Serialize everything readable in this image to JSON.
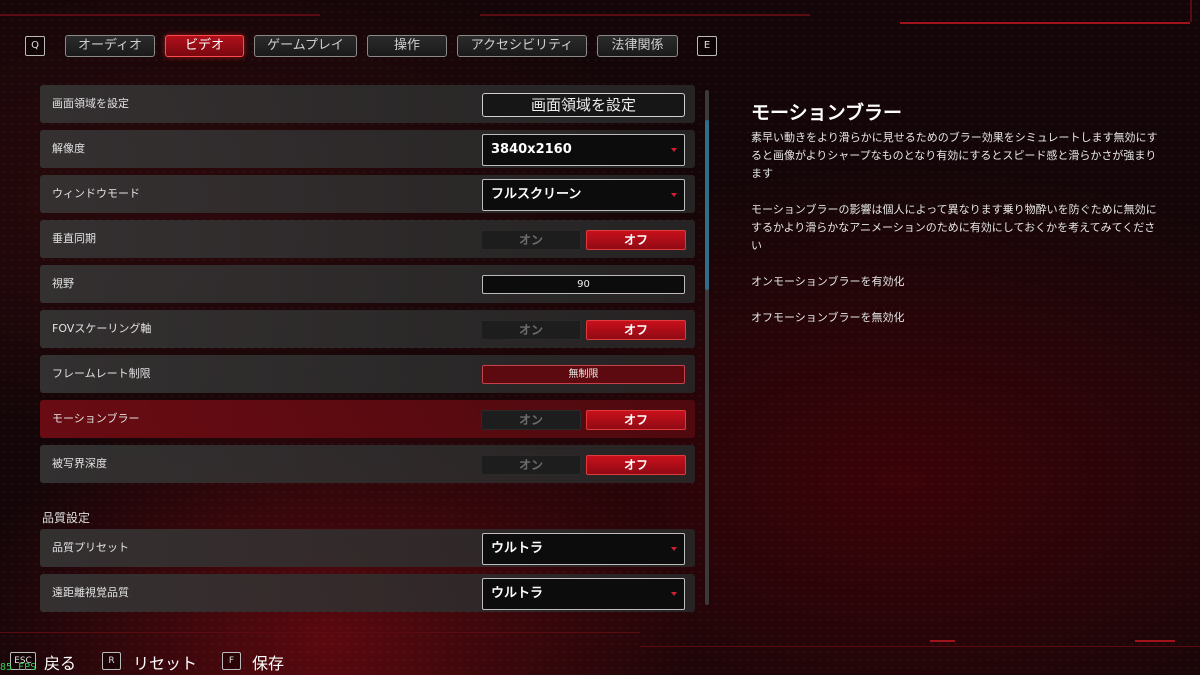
{
  "tabs": {
    "prev_key": "Q",
    "next_key": "E",
    "items": [
      {
        "label": "オーディオ"
      },
      {
        "label": "ビデオ"
      },
      {
        "label": "ゲームプレイ"
      },
      {
        "label": "操作"
      },
      {
        "label": "アクセシビリティ"
      },
      {
        "label": "法律関係"
      }
    ],
    "active": "ビデオ"
  },
  "settings": {
    "screen_area": {
      "label": "画面領域を設定",
      "button": "画面領域を設定"
    },
    "resolution": {
      "label": "解像度",
      "value": "3840x2160"
    },
    "window_mode": {
      "label": "ウィンドウモード",
      "value": "フルスクリーン"
    },
    "vsync": {
      "label": "垂直同期",
      "on": "オン",
      "off": "オフ",
      "selected": "オフ"
    },
    "fov": {
      "label": "視野",
      "value": "90"
    },
    "fov_scaling": {
      "label": "FOVスケーリング軸",
      "on": "オン",
      "off": "オフ",
      "selected": "オフ"
    },
    "framerate_limit": {
      "label": "フレームレート制限",
      "value": "無制限"
    },
    "motion_blur": {
      "label": "モーションブラー",
      "on": "オン",
      "off": "オフ",
      "selected": "オフ"
    },
    "depth_of_field": {
      "label": "被写界深度",
      "on": "オン",
      "off": "オフ",
      "selected": "オフ"
    },
    "quality_section": "品質設定",
    "quality_preset": {
      "label": "品質プリセット",
      "value": "ウルトラ"
    },
    "far_quality": {
      "label": "遠距離視覚品質",
      "value": "ウルトラ"
    }
  },
  "description": {
    "title": "モーションブラー",
    "para1": "素早い動きをより滑らかに見せるためのブラー効果をシミュレートします無効にすると画像がよりシャープなものとなり有効にするとスピード感と滑らかさが強まります",
    "para2": "モーションブラーの影響は個人によって異なります乗り物酔いを防ぐために無効にするかより滑らかなアニメーションのために有効にしておくかを考えてみてください",
    "on_desc": "オンモーションブラーを有効化",
    "off_desc": "オフモーションブラーを無効化"
  },
  "footer": {
    "back_key": "ESC",
    "back_label": "戻る",
    "reset_key": "R",
    "reset_label": "リセット",
    "save_key": "F",
    "save_label": "保存"
  },
  "fps": "85 FPS",
  "colors": {
    "accent": "#c8101c",
    "scroll": "#2f6e86",
    "fps": "#31d05a"
  }
}
